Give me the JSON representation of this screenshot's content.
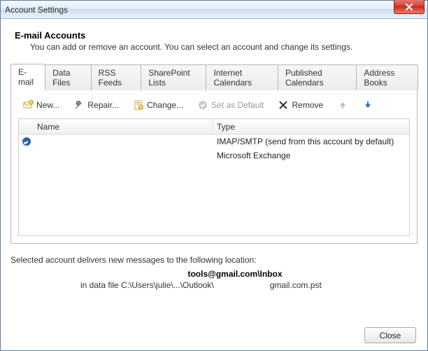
{
  "window": {
    "title": "Account Settings"
  },
  "header": {
    "heading": "E-mail Accounts",
    "sub": "You can add or remove an account. You can select an account and change its settings."
  },
  "tabs": [
    {
      "label": "E-mail",
      "active": true
    },
    {
      "label": "Data Files"
    },
    {
      "label": "RSS Feeds"
    },
    {
      "label": "SharePoint Lists"
    },
    {
      "label": "Internet Calendars"
    },
    {
      "label": "Published Calendars"
    },
    {
      "label": "Address Books"
    }
  ],
  "toolbar": {
    "new": "New...",
    "repair": "Repair...",
    "change": "Change...",
    "set_default": "Set as Default",
    "remove": "Remove"
  },
  "table": {
    "cols": {
      "name": "Name",
      "type": "Type"
    },
    "rows": [
      {
        "name": "",
        "type": "IMAP/SMTP (send from this account by default)",
        "is_default": true
      },
      {
        "name": "",
        "type": "Microsoft Exchange",
        "is_default": false
      }
    ]
  },
  "delivery": {
    "intro": "Selected account delivers new messages to the following location:",
    "bold": "tools@gmail.com\\Inbox",
    "path_prefix": "in data file C:\\Users\\julie\\...\\Outlook\\",
    "path_suffix": "gmail.com.pst"
  },
  "buttons": {
    "close": "Close"
  }
}
